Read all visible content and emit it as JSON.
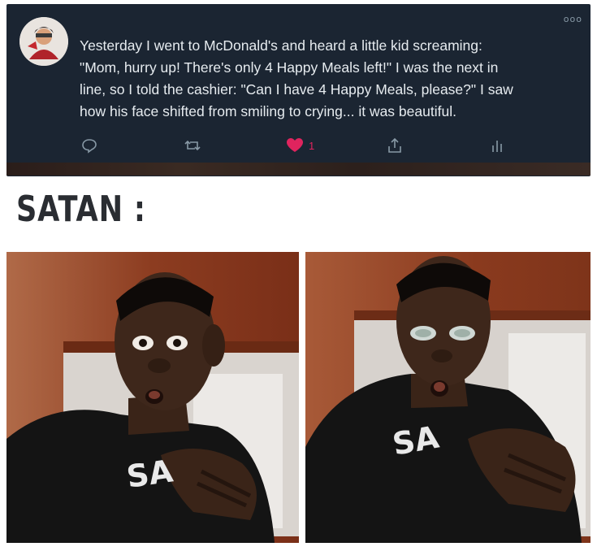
{
  "tweet": {
    "text_lines": [
      "Yesterday I went to McDonald's and heard a little kid screaming:",
      "\"Mom, hurry up! There's only 4 Happy Meals left!\" I was the next in",
      "line, so I told the cashier: \"Can I have 4 Happy Meals, please?\" I saw",
      "how his face shifted from smiling to crying... it was beautiful."
    ],
    "like_count": "1",
    "icons": [
      "reply-icon",
      "retweet-icon",
      "heart-icon",
      "share-icon",
      "analytics-icon",
      "more-icon"
    ],
    "colors": {
      "background": "#1b2532",
      "text": "#e6ebef",
      "icon": "#8899a6",
      "like": "#e0245e"
    }
  },
  "meme": {
    "title": "SATAN :",
    "shirt_text": "SA"
  }
}
